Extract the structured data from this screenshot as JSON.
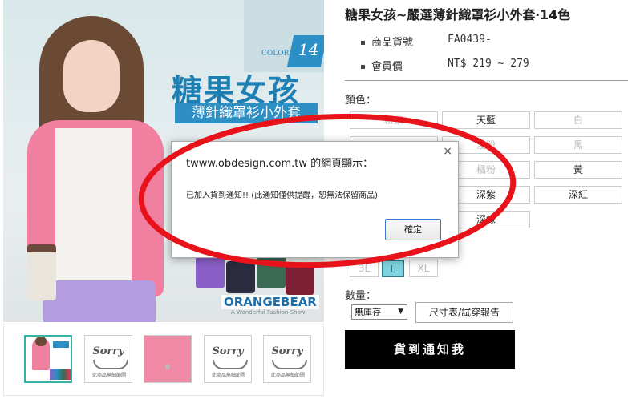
{
  "product": {
    "title": "糖果女孩~嚴選薄針織罩衫小外套‧14色",
    "code_label": "商品貨號",
    "code_value": "FA0439-",
    "price_label": "會員價",
    "price_value": "NT$ 219 ~ 279"
  },
  "image": {
    "brand_title": "糖果女孩",
    "brand_subtitle": "薄針織罩衫小外套",
    "colors_label": "COLORS",
    "colors_count": "14",
    "watermark": "ORANGEBEAR",
    "watermark_sub": "A Wonderful Fashion Show"
  },
  "thumbnails": [
    {
      "type": "photo"
    },
    {
      "type": "sorry",
      "title": "Sorry",
      "sub": "此商品無細節圖"
    },
    {
      "type": "detail"
    },
    {
      "type": "sorry",
      "title": "Sorry",
      "sub": "此商品無細節圖"
    },
    {
      "type": "sorry",
      "title": "Sorry",
      "sub": "此商品無細節圖"
    }
  ],
  "color_section": {
    "label": "顏色：",
    "options": [
      {
        "label": "粉紫",
        "disabled": true
      },
      {
        "label": "天藍",
        "disabled": false
      },
      {
        "label": "白",
        "disabled": true
      },
      {
        "label": "",
        "disabled": true
      },
      {
        "label": "淺粉",
        "disabled": true
      },
      {
        "label": "黑",
        "disabled": true
      },
      {
        "label": "",
        "disabled": true
      },
      {
        "label": "橘粉",
        "disabled": true
      },
      {
        "label": "黃",
        "disabled": false
      },
      {
        "label": "",
        "disabled": false
      },
      {
        "label": "深紫",
        "disabled": false
      },
      {
        "label": "深紅",
        "disabled": false
      },
      {
        "label": "",
        "disabled": false
      },
      {
        "label": "深綠",
        "disabled": false
      }
    ]
  },
  "sizes": [
    {
      "label": "3L",
      "selected": false
    },
    {
      "label": "L",
      "selected": true
    },
    {
      "label": "XL",
      "selected": false
    }
  ],
  "quantity": {
    "label": "數量：",
    "select_value": "無庫存"
  },
  "size_chart_button": "尺寸表/試穿報告",
  "notify_button": "貨到通知我",
  "dialog": {
    "title": "twww.obdesign.com.tw 的網頁顯示：",
    "message": "已加入貨到通知!! (此通知僅供提醒，恕無法保留商品)",
    "ok_label": "確定",
    "close_glyph": "×"
  },
  "colors": {
    "highlight_ring": "#e8131a",
    "notify_bg": "#000000",
    "brand_blue": "#1e7fb5"
  }
}
